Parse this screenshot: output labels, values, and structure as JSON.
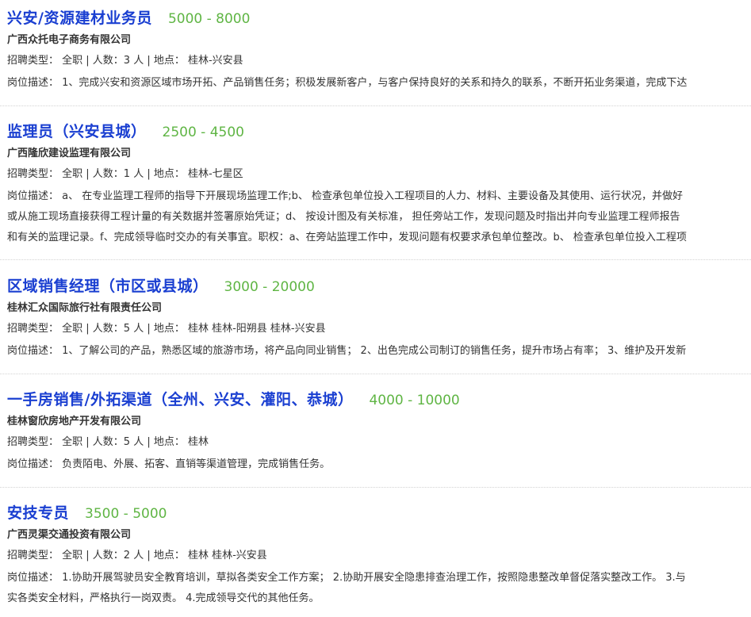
{
  "labels": {
    "type": "招聘类型：",
    "desc": "岗位描述："
  },
  "jobs": [
    {
      "title": "兴安/资源建材业务员",
      "salary": "5000 - 8000",
      "company": "广西众托电子商务有限公司",
      "meta": "全职 | 人数：3 人 | 地点： 桂林-兴安县",
      "desc_lines": [
        "1、完成兴安和资源区域市场开拓、产品销售任务；积极发展新客户，与客户保持良好的关系和持久的联系，不断开拓业务渠道，完成下达"
      ]
    },
    {
      "title": "监理员（兴安县城）",
      "salary": "2500 - 4500",
      "company": "广西隆欣建设监理有限公司",
      "meta": "全职 | 人数：1 人 | 地点： 桂林-七星区",
      "desc_lines": [
        "a、 在专业监理工程师的指导下开展现场监理工作;b、 检查承包单位投入工程项目的人力、材料、主要设备及其使用、运行状况，并做好",
        "或从施工现场直接获得工程计量的有关数据并签署原始凭证；d、 按设计图及有关标准， 担任旁站工作，发现问题及时指出并向专业监理工程师报告",
        "和有关的监理记录。f、完成领导临时交办的有关事宜。职权：a、在旁站监理工作中，发现问题有权要求承包单位整改。b、 检查承包单位投入工程项"
      ]
    },
    {
      "title": "区域销售经理（市区或县城）",
      "salary": "3000 - 20000",
      "company": "桂林汇众国际旅行社有限责任公司",
      "meta": "全职 | 人数：5 人 | 地点： 桂林 桂林-阳朔县 桂林-兴安县",
      "desc_lines": [
        "1、了解公司的产品，熟悉区域的旅游市场，将产品向同业销售； 2、出色完成公司制订的销售任务，提升市场占有率； 3、维护及开发新"
      ]
    },
    {
      "title": "一手房销售/外拓渠道（全州、兴安、灌阳、恭城）",
      "salary": "4000 - 10000",
      "company": "桂林窗欣房地产开发有限公司",
      "meta": "全职 | 人数：5 人 | 地点： 桂林",
      "desc_lines": [
        "负责陌电、外展、拓客、直销等渠道管理，完成销售任务。"
      ]
    },
    {
      "title": "安技专员",
      "salary": "3500 - 5000",
      "company": "广西灵渠交通投资有限公司",
      "meta": "全职 | 人数：2 人 | 地点： 桂林 桂林-兴安县",
      "desc_lines": [
        "1.协助开展驾驶员安全教育培训，草拟各类安全工作方案； 2.协助开展安全隐患排查治理工作，按照隐患整改单督促落实整改工作。 3.与",
        "实各类安全材料，严格执行一岗双责。 4.完成领导交代的其他任务。"
      ]
    }
  ]
}
